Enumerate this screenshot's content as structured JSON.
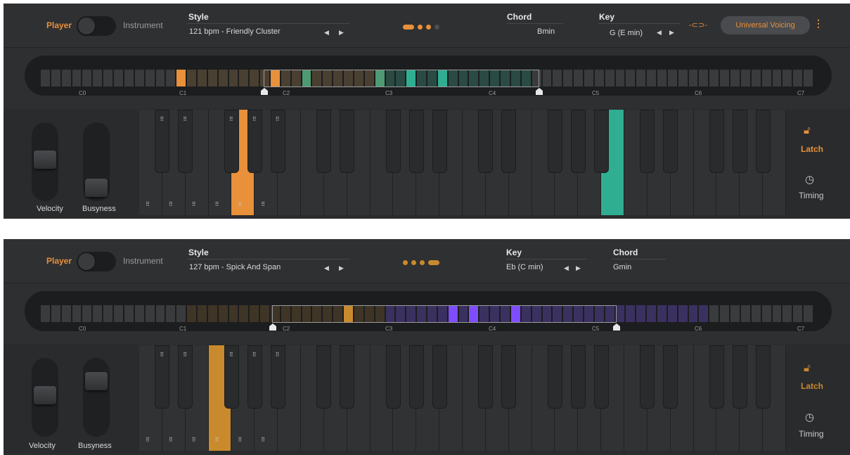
{
  "panels": [
    {
      "mode_player": "Player",
      "mode_instrument": "Instrument",
      "style_label": "Style",
      "style_value": "121 bpm - Friendly Cluster",
      "chord_label": "Chord",
      "chord_value": "Bmin",
      "key_label": "Key",
      "key_value": "G (E min)",
      "voicing_button": "Universal Voicing",
      "octaves": [
        "C0",
        "C1",
        "C2",
        "C3",
        "C4",
        "C5",
        "C6",
        "C7"
      ],
      "velocity_label": "Velocity",
      "busyness_label": "Busyness",
      "latch_label": "Latch",
      "timing_label": "Timing",
      "accent": "#e8903a",
      "chord_color": "#2fae92"
    },
    {
      "mode_player": "Player",
      "mode_instrument": "Instrument",
      "style_label": "Style",
      "style_value": "127 bpm - Spick And Span",
      "key_label": "Key",
      "key_value": "Eb (C min)",
      "chord_label": "Chord",
      "chord_value": "Gmin",
      "octaves": [
        "C0",
        "C1",
        "C2",
        "C3",
        "C4",
        "C5",
        "C6",
        "C7"
      ],
      "velocity_label": "Velocity",
      "busyness_label": "Busyness",
      "latch_label": "Latch",
      "timing_label": "Timing",
      "accent": "#c98a2e",
      "chord_color": "#7d4dff"
    }
  ]
}
